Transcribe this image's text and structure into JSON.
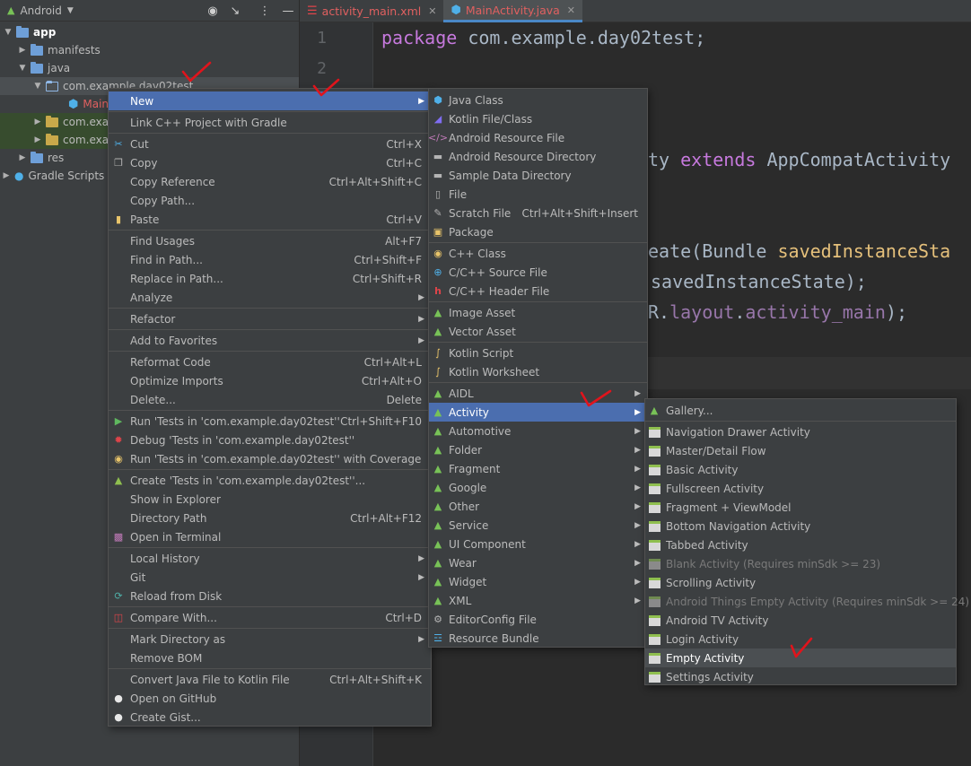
{
  "project_panel": {
    "view_title": "Android",
    "tree": [
      {
        "label": "app"
      },
      {
        "label": "manifests"
      },
      {
        "label": "java"
      },
      {
        "label": "com.example.day02test"
      },
      {
        "label": "Main"
      },
      {
        "label": "com.exa"
      },
      {
        "label": "com.exa"
      },
      {
        "label": "res"
      },
      {
        "label": "Gradle Scripts"
      }
    ]
  },
  "editor": {
    "tabs": [
      {
        "label": "activity_main.xml"
      },
      {
        "label": "MainActivity.java"
      }
    ],
    "line_numbers": [
      "1",
      "2"
    ],
    "code": {
      "line1_kw": "package",
      "line1_rest": " com.example.day02test;",
      "frag1_a": "ty ",
      "frag1_kw": "extends",
      "frag1_b": " AppCompatActivity",
      "frag2_a": "eate(Bundle ",
      "frag2_b": "savedInstanceSta",
      "frag3": "savedInstanceState);",
      "frag4_a": "R.",
      "frag4_b": "layout",
      "frag4_c": ".",
      "frag4_d": "activity_main",
      "frag4_e": ");"
    }
  },
  "context_menu": {
    "items": [
      {
        "label": "New",
        "shortcut": ""
      },
      {
        "label": "Link C++ Project with Gradle",
        "shortcut": ""
      },
      {
        "label": "Cut",
        "shortcut": "Ctrl+X"
      },
      {
        "label": "Copy",
        "shortcut": "Ctrl+C"
      },
      {
        "label": "Copy Reference",
        "shortcut": "Ctrl+Alt+Shift+C"
      },
      {
        "label": "Copy Path...",
        "shortcut": ""
      },
      {
        "label": "Paste",
        "shortcut": "Ctrl+V"
      },
      {
        "label": "Find Usages",
        "shortcut": "Alt+F7"
      },
      {
        "label": "Find in Path...",
        "shortcut": "Ctrl+Shift+F"
      },
      {
        "label": "Replace in Path...",
        "shortcut": "Ctrl+Shift+R"
      },
      {
        "label": "Analyze",
        "shortcut": ""
      },
      {
        "label": "Refactor",
        "shortcut": ""
      },
      {
        "label": "Add to Favorites",
        "shortcut": ""
      },
      {
        "label": "Reformat Code",
        "shortcut": "Ctrl+Alt+L"
      },
      {
        "label": "Optimize Imports",
        "shortcut": "Ctrl+Alt+O"
      },
      {
        "label": "Delete...",
        "shortcut": "Delete"
      },
      {
        "label": "Run 'Tests in 'com.example.day02test''",
        "shortcut": "Ctrl+Shift+F10"
      },
      {
        "label": "Debug 'Tests in 'com.example.day02test''",
        "shortcut": ""
      },
      {
        "label": "Run 'Tests in 'com.example.day02test'' with Coverage",
        "shortcut": ""
      },
      {
        "label": "Create 'Tests in 'com.example.day02test''...",
        "shortcut": ""
      },
      {
        "label": "Show in Explorer",
        "shortcut": ""
      },
      {
        "label": "Directory Path",
        "shortcut": "Ctrl+Alt+F12"
      },
      {
        "label": "Open in Terminal",
        "shortcut": ""
      },
      {
        "label": "Local History",
        "shortcut": ""
      },
      {
        "label": "Git",
        "shortcut": ""
      },
      {
        "label": "Reload from Disk",
        "shortcut": ""
      },
      {
        "label": "Compare With...",
        "shortcut": "Ctrl+D"
      },
      {
        "label": "Mark Directory as",
        "shortcut": ""
      },
      {
        "label": "Remove BOM",
        "shortcut": ""
      },
      {
        "label": "Convert Java File to Kotlin File",
        "shortcut": "Ctrl+Alt+Shift+K"
      },
      {
        "label": "Open on GitHub",
        "shortcut": ""
      },
      {
        "label": "Create Gist...",
        "shortcut": ""
      }
    ]
  },
  "new_menu": {
    "items": [
      {
        "label": "Java Class",
        "shortcut": ""
      },
      {
        "label": "Kotlin File/Class",
        "shortcut": ""
      },
      {
        "label": "Android Resource File",
        "shortcut": ""
      },
      {
        "label": "Android Resource Directory",
        "shortcut": ""
      },
      {
        "label": "Sample Data Directory",
        "shortcut": ""
      },
      {
        "label": "File",
        "shortcut": ""
      },
      {
        "label": "Scratch File",
        "shortcut": "Ctrl+Alt+Shift+Insert"
      },
      {
        "label": "Package",
        "shortcut": ""
      },
      {
        "label": "C++ Class",
        "shortcut": ""
      },
      {
        "label": "C/C++ Source File",
        "shortcut": ""
      },
      {
        "label": "C/C++ Header File",
        "shortcut": ""
      },
      {
        "label": "Image Asset",
        "shortcut": ""
      },
      {
        "label": "Vector Asset",
        "shortcut": ""
      },
      {
        "label": "Kotlin Script",
        "shortcut": ""
      },
      {
        "label": "Kotlin Worksheet",
        "shortcut": ""
      },
      {
        "label": "AIDL",
        "shortcut": ""
      },
      {
        "label": "Activity",
        "shortcut": ""
      },
      {
        "label": "Automotive",
        "shortcut": ""
      },
      {
        "label": "Folder",
        "shortcut": ""
      },
      {
        "label": "Fragment",
        "shortcut": ""
      },
      {
        "label": "Google",
        "shortcut": ""
      },
      {
        "label": "Other",
        "shortcut": ""
      },
      {
        "label": "Service",
        "shortcut": ""
      },
      {
        "label": "UI Component",
        "shortcut": ""
      },
      {
        "label": "Wear",
        "shortcut": ""
      },
      {
        "label": "Widget",
        "shortcut": ""
      },
      {
        "label": "XML",
        "shortcut": ""
      },
      {
        "label": "EditorConfig File",
        "shortcut": ""
      },
      {
        "label": "Resource Bundle",
        "shortcut": ""
      }
    ]
  },
  "activity_menu": {
    "items": [
      {
        "label": "Gallery..."
      },
      {
        "label": "Navigation Drawer Activity"
      },
      {
        "label": "Master/Detail Flow"
      },
      {
        "label": "Basic Activity"
      },
      {
        "label": "Fullscreen Activity"
      },
      {
        "label": "Fragment + ViewModel"
      },
      {
        "label": "Bottom Navigation Activity"
      },
      {
        "label": "Tabbed Activity"
      },
      {
        "label": "Blank Activity (Requires minSdk >= 23)"
      },
      {
        "label": "Scrolling Activity"
      },
      {
        "label": "Android Things Empty Activity (Requires minSdk >= 24)"
      },
      {
        "label": "Android TV Activity"
      },
      {
        "label": "Login Activity"
      },
      {
        "label": "Empty Activity"
      },
      {
        "label": "Settings Activity"
      }
    ]
  },
  "colors": {
    "selection": "#4b6eaf",
    "annotation": "#e0141c",
    "android_green": "#78c257"
  }
}
